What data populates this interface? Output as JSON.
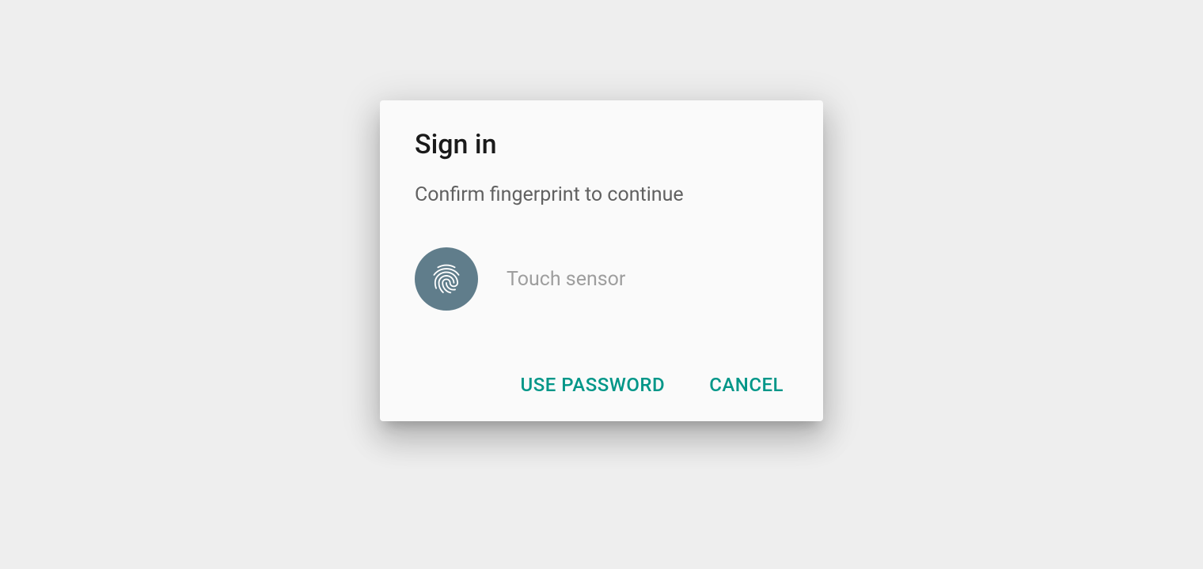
{
  "dialog": {
    "title": "Sign in",
    "subtitle": "Confirm fingerprint to continue",
    "sensor_label": "Touch sensor",
    "actions": {
      "use_password": "USE PASSWORD",
      "cancel": "CANCEL"
    }
  },
  "colors": {
    "accent": "#009688",
    "icon_bg": "#607d8b"
  }
}
